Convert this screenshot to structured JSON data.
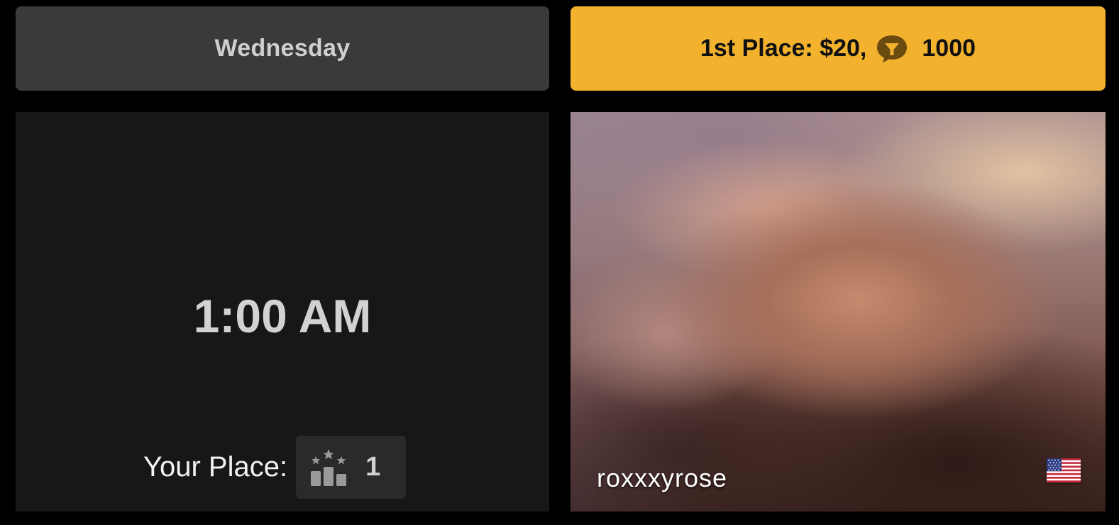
{
  "day_header": {
    "label": "Wednesday"
  },
  "prize_header": {
    "prefix": "1st Place: $20,",
    "token_icon": "tokens-icon",
    "token_amount": "1000",
    "accent_color": "#f2b22e"
  },
  "timer": {
    "time": "1:00 AM"
  },
  "your_place": {
    "label": "Your Place:",
    "icon": "podium-stars-icon",
    "value": "1"
  },
  "model_card": {
    "username": "roxxxyrose",
    "flag_icon": "us-flag-icon"
  },
  "colors": {
    "background": "#000000",
    "panel": "#171717",
    "day_header_bg": "#3a3a3a",
    "text_muted": "#d2d2d2"
  }
}
